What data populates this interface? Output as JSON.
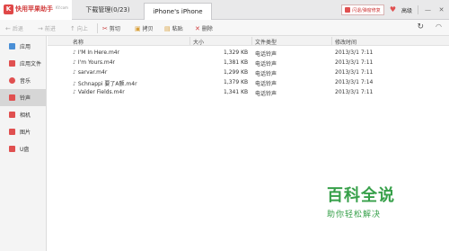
{
  "app": {
    "logo_text": "快用苹果助手",
    "logo_sub": "KY.com"
  },
  "tabs": {
    "download": "下载管理(0/23)",
    "device": "iPhone's iPhone"
  },
  "title_right": {
    "flash_label": "闪退/弹窗修复",
    "quality_label": "高级"
  },
  "toolbar": {
    "back": "后退",
    "forward": "前进",
    "up": "向上",
    "cut": "剪切",
    "copy": "拷贝",
    "paste": "粘贴",
    "delete": "删除"
  },
  "sidebar": {
    "items": [
      {
        "label": "应用",
        "icon": "apps-icon",
        "color": "#4a8fd6"
      },
      {
        "label": "应用文件",
        "icon": "app-files-icon",
        "color": "#e05050"
      },
      {
        "label": "音乐",
        "icon": "music-icon",
        "color": "#e05050"
      },
      {
        "label": "铃声",
        "icon": "ringtone-icon",
        "color": "#e05050",
        "active": true
      },
      {
        "label": "相机",
        "icon": "camera-icon",
        "color": "#e05050"
      },
      {
        "label": "图片",
        "icon": "pictures-icon",
        "color": "#e05050"
      },
      {
        "label": "U盘",
        "icon": "usb-drive-icon",
        "color": "#e05050"
      }
    ]
  },
  "table": {
    "columns": [
      "名称",
      "大小",
      "文件类型",
      "修改时间"
    ],
    "rows": [
      {
        "name": "I'M In Here.m4r",
        "size": "1,329 KB",
        "type": "电话铃声",
        "date": "2013/3/1 7:11"
      },
      {
        "name": "I'm Yours.m4r",
        "size": "1,381 KB",
        "type": "电话铃声",
        "date": "2013/3/1 7:11"
      },
      {
        "name": "sarvar.m4r",
        "size": "1,299 KB",
        "type": "电话铃声",
        "date": "2013/3/1 7:11"
      },
      {
        "name": "Schnappi   要了A颤.m4r",
        "size": "1,379 KB",
        "type": "电话铃声",
        "date": "2013/3/1 7:14"
      },
      {
        "name": "Valder Fields.m4r",
        "size": "1,341 KB",
        "type": "电话铃声",
        "date": "2013/3/1 7:11"
      }
    ]
  },
  "watermark": {
    "title": "百科全说",
    "subtitle": "助你轻松解决"
  }
}
